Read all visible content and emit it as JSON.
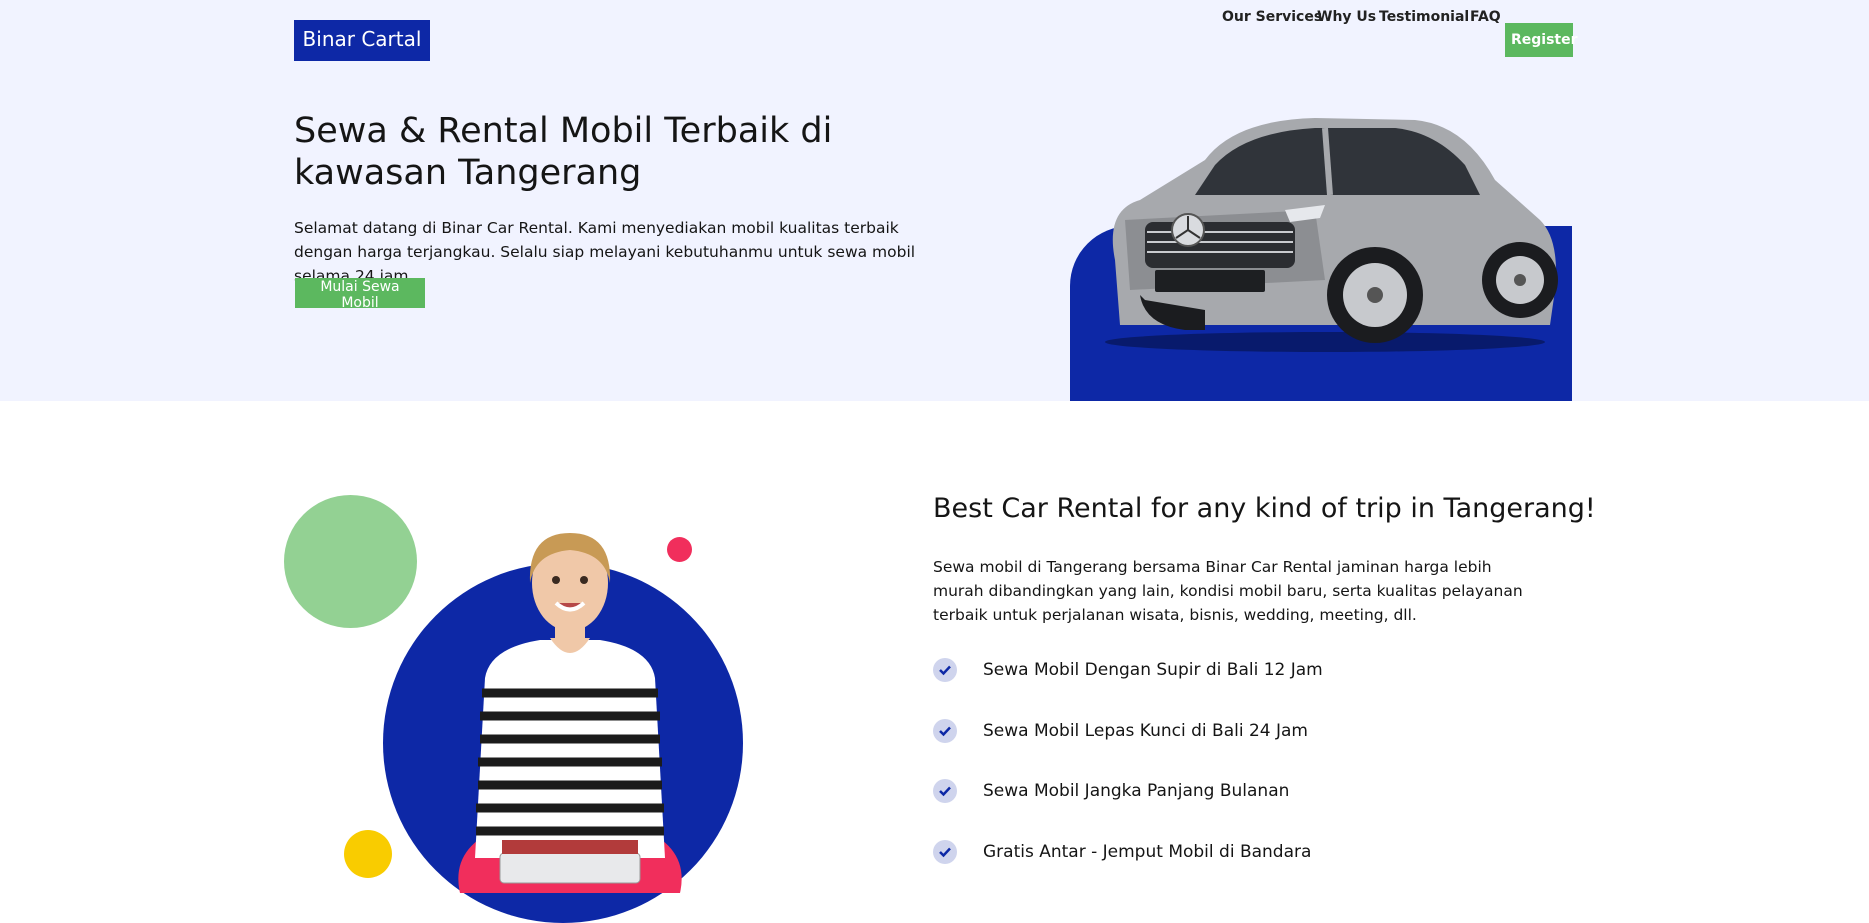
{
  "header": {
    "logo": "Binar Cartal",
    "nav": [
      {
        "label": "Our Services"
      },
      {
        "label": "Why Us"
      },
      {
        "label": "Testimonial"
      },
      {
        "label": "FAQ"
      }
    ],
    "register_label": "Register"
  },
  "hero": {
    "title": "Sewa & Rental Mobil Terbaik di kawasan Tangerang",
    "description": "Selamat datang di Binar Car Rental. Kami menyediakan mobil kualitas terbaik dengan harga terjangkau. Selalu siap melayani kebutuhanmu untuk sewa mobil selama 24 jam.",
    "cta_label": "Mulai Sewa Mobil"
  },
  "services": {
    "title": "Best Car Rental for any kind of trip in Tangerang!",
    "description": "Sewa mobil di Tangerang bersama Binar Car Rental jaminan harga lebih murah dibandingkan yang lain, kondisi mobil baru, serta kualitas pelayanan terbaik untuk perjalanan wisata, bisnis, wedding, meeting, dll.",
    "features": [
      {
        "label": "Sewa Mobil Dengan Supir di Bali 12 Jam"
      },
      {
        "label": "Sewa Mobil Lepas Kunci di Bali 24 Jam"
      },
      {
        "label": "Sewa Mobil Jangka Panjang Bulanan"
      },
      {
        "label": "Gratis Antar - Jemput Mobil di Bandara"
      }
    ]
  },
  "colors": {
    "brand_blue": "#0d28a6",
    "cta_green": "#5cb85f",
    "hero_bg": "#f1f3ff"
  }
}
